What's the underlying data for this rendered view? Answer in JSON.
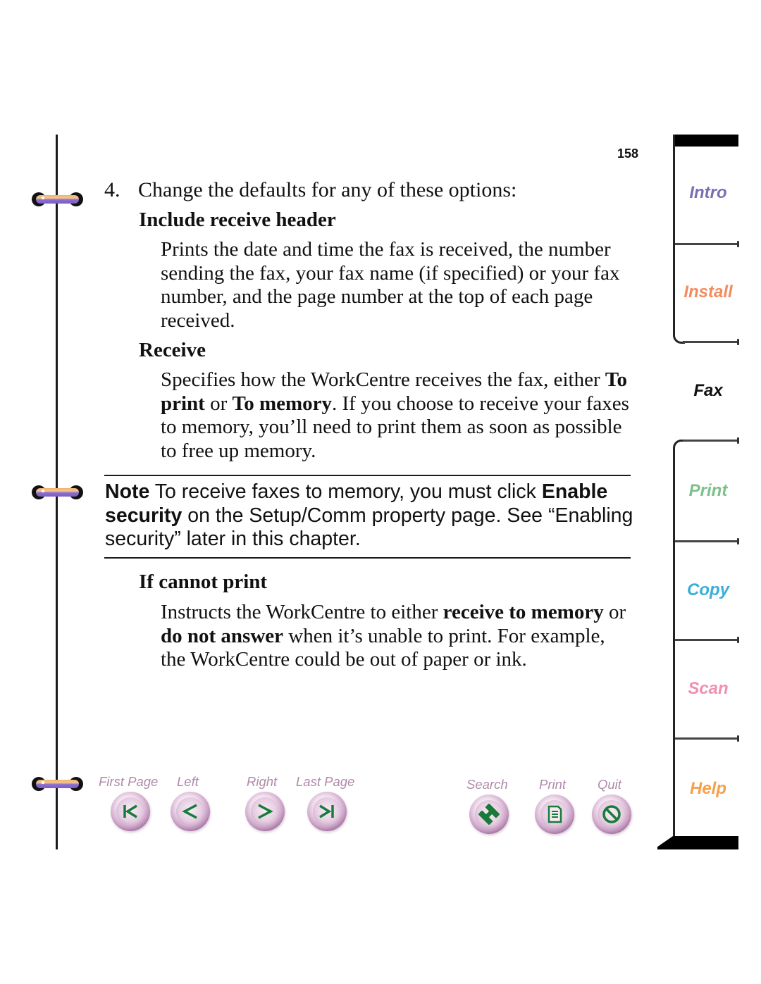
{
  "page": {
    "number": "158"
  },
  "content": {
    "step_number": "4.",
    "step_text": "Change the defaults for any of these options:",
    "options": [
      {
        "heading": "Include receive header",
        "body": [
          {
            "text": "Prints the date and time the fax is received, the number sending the fax, your fax name (if specified) or your fax number, and the page number at the top of each page received.",
            "bold": false
          }
        ]
      },
      {
        "heading": "Receive",
        "body": [
          {
            "text": "Specifies how the WorkCentre receives the fax, either ",
            "bold": false
          },
          {
            "text": "To print",
            "bold": true
          },
          {
            "text": " or ",
            "bold": false
          },
          {
            "text": "To memory",
            "bold": true
          },
          {
            "text": ". If you choose to receive your faxes to memory, you’ll need to print them as soon as possible to free up memory.",
            "bold": false
          }
        ]
      },
      {
        "heading": "If cannot print",
        "body": [
          {
            "text": "Instructs the WorkCentre to either ",
            "bold": false
          },
          {
            "text": "receive to memory",
            "bold": true
          },
          {
            "text": " or ",
            "bold": false
          },
          {
            "text": "do not answer",
            "bold": true
          },
          {
            "text": " when it’s unable to print. For example, the WorkCentre could be out of paper or ink.",
            "bold": false
          }
        ]
      }
    ],
    "note": {
      "label": "Note",
      "parts": [
        {
          "text": "  To receive faxes to memory, you must click ",
          "bold": false
        },
        {
          "text": "Enable security",
          "bold": true
        },
        {
          "text": " on the Setup/Comm property page. See “Enabling security” later in this chapter.",
          "bold": false
        }
      ]
    }
  },
  "tabs": [
    {
      "label": "Intro",
      "color": "#7a6fb4",
      "active": false
    },
    {
      "label": "Install",
      "color": "#f28c5e",
      "active": false
    },
    {
      "label": "Fax",
      "color": "#111111",
      "active": true
    },
    {
      "label": "Print",
      "color": "#7cc08a",
      "active": false
    },
    {
      "label": "Copy",
      "color": "#3aaed8",
      "active": false
    },
    {
      "label": "Scan",
      "color": "#f090b0",
      "active": false
    },
    {
      "label": "Help",
      "color": "#f5a04a",
      "active": false
    }
  ],
  "nav": {
    "first_page": {
      "label": "First Page",
      "icon": "first-page-icon"
    },
    "left": {
      "label": "Left",
      "icon": "arrow-left-icon"
    },
    "right": {
      "label": "Right",
      "icon": "arrow-right-icon"
    },
    "last_page": {
      "label": "Last Page",
      "icon": "last-page-icon"
    },
    "search": {
      "label": "Search",
      "icon": "binoculars-icon"
    },
    "print": {
      "label": "Print",
      "icon": "document-icon"
    },
    "quit": {
      "label": "Quit",
      "icon": "no-entry-icon"
    },
    "label_color": "#b08aaa",
    "icon_color": "#1a7a3a"
  }
}
